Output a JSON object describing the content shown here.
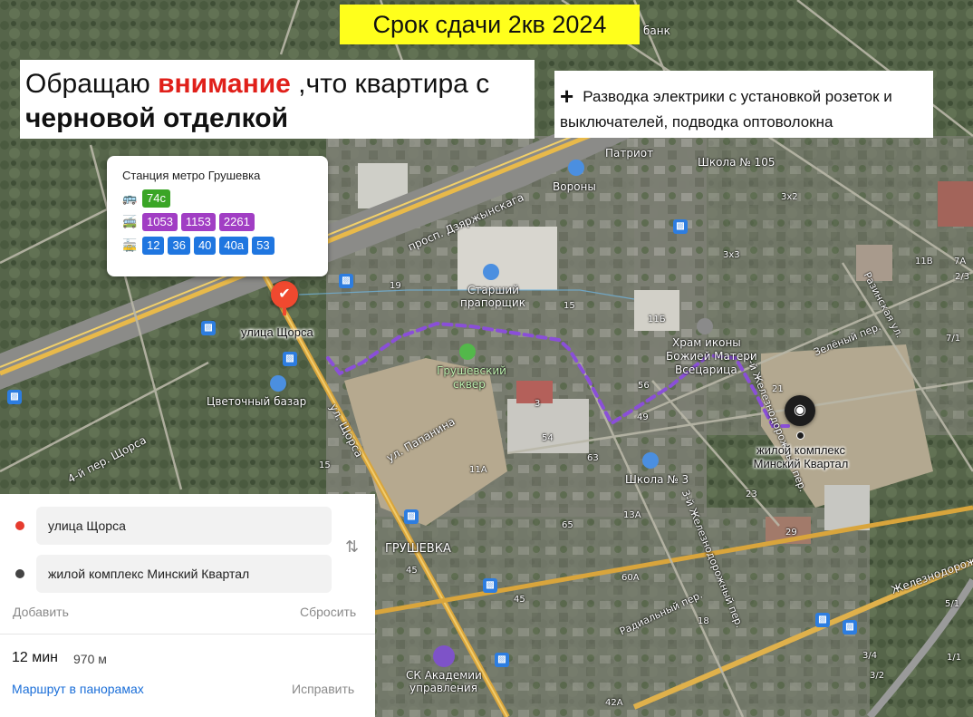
{
  "banners": {
    "deadline": "Срок сдачи 2кв 2024",
    "attention_pre": "Обращаю ",
    "attention_red": "внимание",
    "attention_post": " ,что квартира с",
    "attention_line2": "черновой отделкой",
    "note_plus": "+",
    "note_line1": "Разводка электрики с установкой розеток и",
    "note_line2": "выключателей, подводка оптоволокна"
  },
  "metro_card": {
    "title": "Станция метро Грушевка",
    "bus_routes": [
      "74с"
    ],
    "trolleybus_routes": [
      "1053",
      "1153",
      "2261"
    ],
    "tram_routes": [
      "12",
      "36",
      "40",
      "40а",
      "53"
    ],
    "colors": {
      "bus": "#3aa526",
      "trolleybus": "#a13ec4",
      "tram": "#1f76e0"
    }
  },
  "map": {
    "start_label": "улица Щорса",
    "end_label_line1": "жилой комплекс",
    "end_label_line2": "Минский Квартал",
    "street_labels": {
      "dzerzhinsky": "просп. Дзяржынскага",
      "shchorsa": "ул. Щорса",
      "papanina": "ул. Папанина",
      "gorkogo": "ул. Горького",
      "shchorsa_lane": "4-й пер. Щорса",
      "zhelezn": "1-й Железнодорожный пер.",
      "zhelezn2": "3-й Железнодорожный пер.",
      "zhelezn_ul": "Железнодорожная ул.",
      "zelenyi": "Зелёный пер.",
      "razinskaya": "Разинская ул.",
      "radialny": "Радиальный пер.",
      "grushevka": "ГРУШЕВКА",
      "grushevsky": "Грушевский",
      "skver": "сквер",
      "starshy": "Старший",
      "praporshchik": "прапорщик",
      "tsvet_bazar": "Цветочный базар",
      "khram1": "Храм иконы",
      "khram2": "Божией Матери",
      "khram3": "Всецарица",
      "school3": "Школа № 3",
      "school105": "Школа № 105",
      "sk_academy1": "СК Академии",
      "sk_academy2": "управления",
      "vorota": "Вороны",
      "patriot": "Патриот",
      "bank": "банк"
    },
    "building_numbers": [
      "19",
      "15",
      "11Б",
      "56",
      "49",
      "21",
      "3",
      "15",
      "54",
      "63",
      "65",
      "60А",
      "13А",
      "23",
      "29",
      "45",
      "42А",
      "18",
      "3/4",
      "1/1",
      "3х3",
      "3х2",
      "11В",
      "7А",
      "2/3",
      "3/2",
      "5/1",
      "7/1",
      "11А",
      "45"
    ],
    "route_color": "#8a4fd8"
  },
  "route_panel": {
    "from": "улица Щорса",
    "to": "жилой комплекс Минский Квартал",
    "from_color": "#e63b2e",
    "to_color": "#444444",
    "add_label": "Добавить",
    "reset_label": "Сбросить",
    "duration": "12 мин",
    "distance": "970 м",
    "panorama_link": "Маршрут в панорамах",
    "fix_label": "Исправить"
  }
}
